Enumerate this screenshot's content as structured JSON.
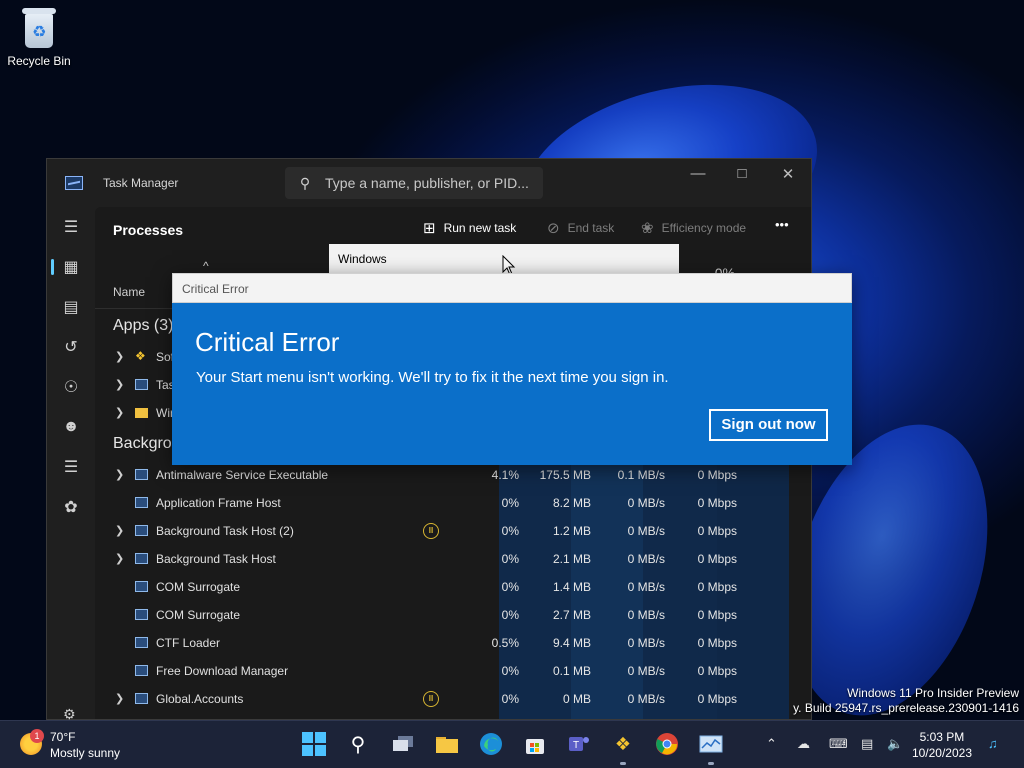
{
  "desktop": {
    "recycle_bin_label": "Recycle Bin",
    "watermark_line1": "Windows 11 Pro Insider Preview",
    "watermark_line2": "y. Build 25947.rs_prerelease.230901-1416"
  },
  "task_manager": {
    "title": "Task Manager",
    "search_placeholder": "Type a name, publisher, or PID...",
    "page_title": "Processes",
    "toolbar": {
      "run_new_task": "Run new task",
      "end_task": "End task",
      "efficiency_mode": "Efficiency mode",
      "more": "•••"
    },
    "columns": {
      "name": "Name",
      "sort_indicator": "^",
      "cpu_percent": "0%"
    },
    "groups": {
      "apps": "Apps (3)",
      "background": "Backgrou"
    },
    "app_rows": [
      {
        "name": "Sof",
        "icon": "bubble-icon"
      },
      {
        "name": "Tas",
        "icon": "chart-icon"
      },
      {
        "name": "Wir",
        "icon": "folder-icon"
      }
    ],
    "background_rows": [
      {
        "name": "Antimalware Service Executable",
        "expandable": true,
        "paused": false,
        "cpu": "4.1%",
        "memory": "175.5 MB",
        "disk": "0.1 MB/s",
        "network": "0 Mbps"
      },
      {
        "name": "Application Frame Host",
        "expandable": false,
        "paused": false,
        "cpu": "0%",
        "memory": "8.2 MB",
        "disk": "0 MB/s",
        "network": "0 Mbps"
      },
      {
        "name": "Background Task Host (2)",
        "expandable": true,
        "paused": true,
        "cpu": "0%",
        "memory": "1.2 MB",
        "disk": "0 MB/s",
        "network": "0 Mbps"
      },
      {
        "name": "Background Task Host",
        "expandable": true,
        "paused": false,
        "cpu": "0%",
        "memory": "2.1 MB",
        "disk": "0 MB/s",
        "network": "0 Mbps"
      },
      {
        "name": "COM Surrogate",
        "expandable": false,
        "paused": false,
        "cpu": "0%",
        "memory": "1.4 MB",
        "disk": "0 MB/s",
        "network": "0 Mbps"
      },
      {
        "name": "COM Surrogate",
        "expandable": false,
        "paused": false,
        "cpu": "0%",
        "memory": "2.7 MB",
        "disk": "0 MB/s",
        "network": "0 Mbps"
      },
      {
        "name": "CTF Loader",
        "expandable": false,
        "paused": false,
        "cpu": "0.5%",
        "memory": "9.4 MB",
        "disk": "0 MB/s",
        "network": "0 Mbps"
      },
      {
        "name": "Free Download Manager",
        "expandable": false,
        "paused": false,
        "cpu": "0%",
        "memory": "0.1 MB",
        "disk": "0 MB/s",
        "network": "0 Mbps"
      },
      {
        "name": "Global.Accounts",
        "expandable": true,
        "paused": true,
        "cpu": "0%",
        "memory": "0 MB",
        "disk": "0 MB/s",
        "network": "0 Mbps"
      }
    ]
  },
  "windows_popup": {
    "label": "Windows"
  },
  "critical_error": {
    "titlebar": "Critical Error",
    "heading": "Critical Error",
    "message": "Your Start menu isn't working. We'll try to fix it the next time you sign in.",
    "button": "Sign out now"
  },
  "taskbar": {
    "weather_badge": "1",
    "temperature": "70°F",
    "condition": "Mostly sunny",
    "time": "5:03 PM",
    "date": "10/20/2023"
  },
  "colors": {
    "dialog_blue": "#0b6fc9",
    "accent": "#60cdff",
    "paused_yellow": "#d7b532",
    "heat_light": "#0f2a4d",
    "heat_mid": "#123258"
  }
}
